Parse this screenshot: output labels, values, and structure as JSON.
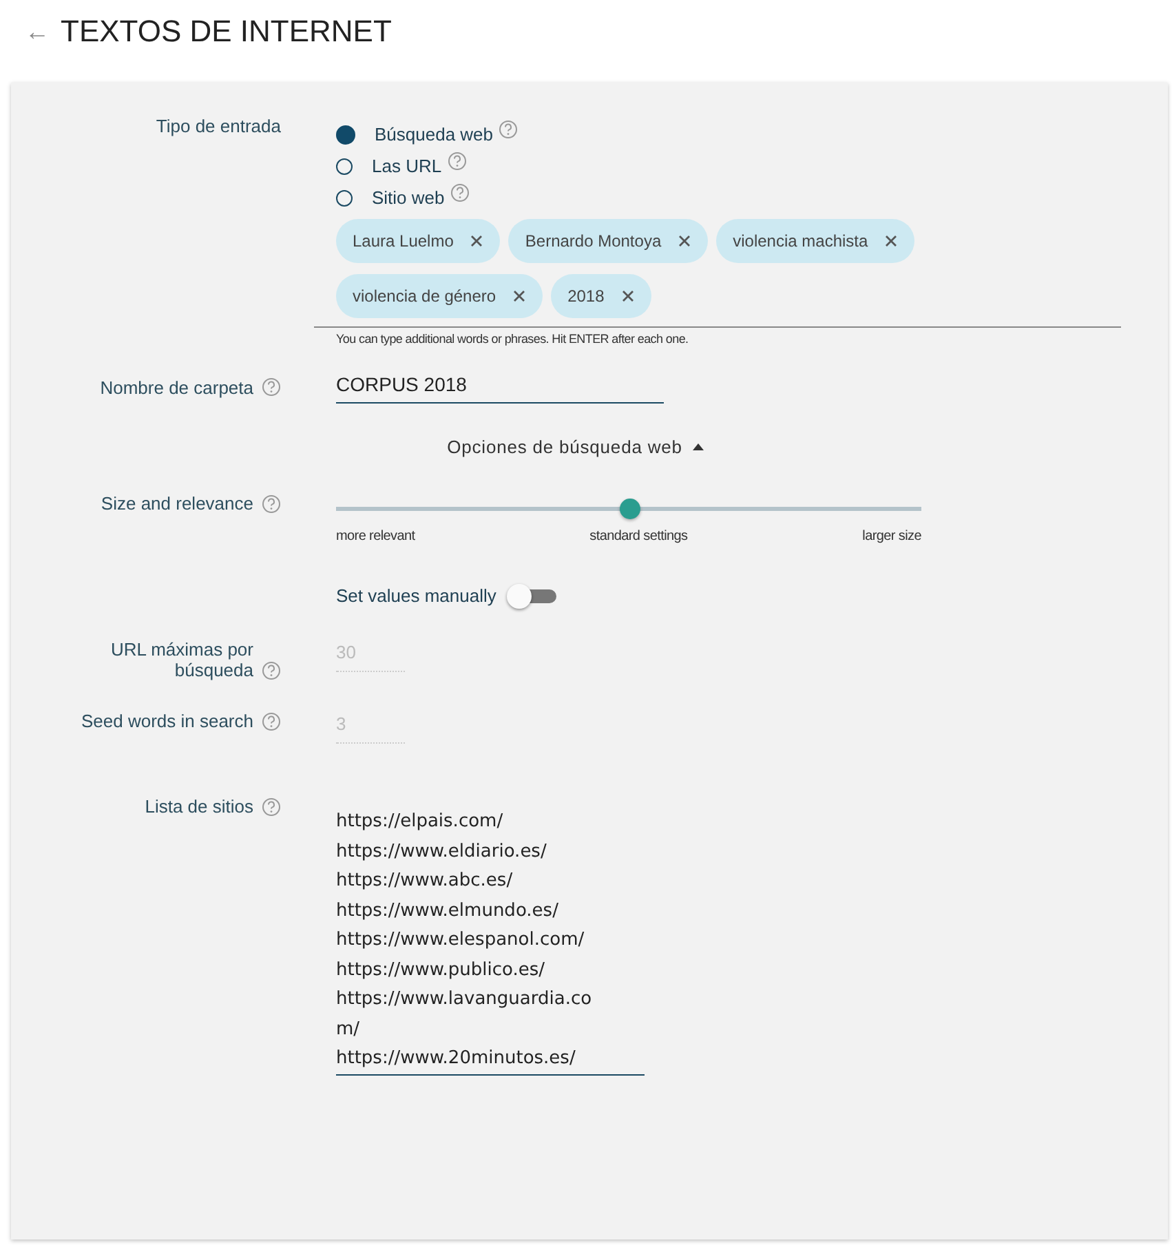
{
  "header": {
    "back": "←",
    "title": "TEXTOS DE INTERNET"
  },
  "input_type": {
    "label": "Tipo de entrada",
    "options": [
      {
        "label": "Búsqueda web",
        "selected": true
      },
      {
        "label": "Las URL",
        "selected": false
      },
      {
        "label": "Sitio web",
        "selected": false
      }
    ]
  },
  "chips": [
    {
      "label": "Laura Luelmo"
    },
    {
      "label": "Bernardo Montoya"
    },
    {
      "label": "violencia machista"
    },
    {
      "label": "violencia de género"
    },
    {
      "label": "2018"
    }
  ],
  "chips_hint": "You can type additional words or phrases. Hit ENTER after each one.",
  "folder": {
    "label": "Nombre de carpeta",
    "value": "CORPUS 2018"
  },
  "options_toggle": {
    "label": "Opciones de búsqueda web",
    "expanded": true
  },
  "size_relevance": {
    "label": "Size and relevance",
    "level": 0.5,
    "ticks": [
      "more relevant",
      "standard settings",
      "larger size"
    ]
  },
  "manual": {
    "label": "Set values manually",
    "on": false
  },
  "max_urls": {
    "label": "URL máximas por búsqueda",
    "value": "30",
    "disabled": true
  },
  "seed_words": {
    "label": "Seed words in search",
    "value": "3",
    "disabled": true
  },
  "sites": {
    "label": "Lista de sitios",
    "items": [
      "https://elpais.com/",
      "https://www.eldiario.es/",
      "https://www.abc.es/",
      "https://www.elmundo.es/",
      "https://www.elespanol.com/",
      "https://www.publico.es/",
      "https://www.lavanguardia.com/",
      "https://www.20minutos.es/"
    ]
  }
}
